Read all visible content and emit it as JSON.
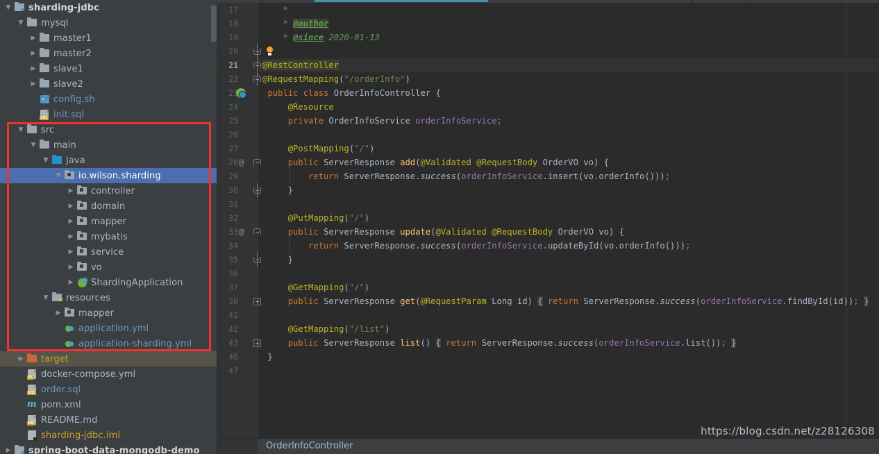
{
  "sidebar": {
    "scrollbar": "vertical-scrollbar",
    "tree": [
      {
        "depth": 0,
        "arrow": "down",
        "icon": "module-folder-icon",
        "label": "sharding-jdbc",
        "style": "bold"
      },
      {
        "depth": 1,
        "arrow": "down",
        "icon": "folder-icon",
        "label": "mysql",
        "style": "plain"
      },
      {
        "depth": 2,
        "arrow": "right",
        "icon": "folder-icon",
        "label": "master1",
        "style": "plain"
      },
      {
        "depth": 2,
        "arrow": "right",
        "icon": "folder-icon",
        "label": "master2",
        "style": "plain"
      },
      {
        "depth": 2,
        "arrow": "right",
        "icon": "folder-icon",
        "label": "slave1",
        "style": "plain"
      },
      {
        "depth": 2,
        "arrow": "right",
        "icon": "folder-icon",
        "label": "slave2",
        "style": "plain"
      },
      {
        "depth": 2,
        "arrow": "none",
        "icon": "shell-script-icon",
        "label": "config.sh",
        "style": "blue"
      },
      {
        "depth": 2,
        "arrow": "none",
        "icon": "sql-file-icon",
        "label": "init.sql",
        "style": "blue"
      },
      {
        "depth": 1,
        "arrow": "down",
        "icon": "folder-icon",
        "label": "src",
        "style": "plain"
      },
      {
        "depth": 2,
        "arrow": "down",
        "icon": "folder-icon",
        "label": "main",
        "style": "plain"
      },
      {
        "depth": 3,
        "arrow": "down",
        "icon": "source-root-icon",
        "label": "java",
        "style": "plain"
      },
      {
        "depth": 4,
        "arrow": "down",
        "icon": "package-icon",
        "label": "io.wilson.sharding",
        "style": "selected"
      },
      {
        "depth": 5,
        "arrow": "right",
        "icon": "package-icon",
        "label": "controller",
        "style": "plain"
      },
      {
        "depth": 5,
        "arrow": "right",
        "icon": "package-icon",
        "label": "domain",
        "style": "plain"
      },
      {
        "depth": 5,
        "arrow": "right",
        "icon": "package-icon",
        "label": "mapper",
        "style": "plain"
      },
      {
        "depth": 5,
        "arrow": "right",
        "icon": "package-icon",
        "label": "mybatis",
        "style": "plain"
      },
      {
        "depth": 5,
        "arrow": "right",
        "icon": "package-icon",
        "label": "service",
        "style": "plain"
      },
      {
        "depth": 5,
        "arrow": "right",
        "icon": "package-icon",
        "label": "vo",
        "style": "plain"
      },
      {
        "depth": 5,
        "arrow": "right",
        "icon": "spring-class-icon",
        "label": "ShardingApplication",
        "style": "plain"
      },
      {
        "depth": 3,
        "arrow": "down",
        "icon": "resources-root-icon",
        "label": "resources",
        "style": "plain"
      },
      {
        "depth": 4,
        "arrow": "right",
        "icon": "package-icon",
        "label": "mapper",
        "style": "plain"
      },
      {
        "depth": 4,
        "arrow": "none",
        "icon": "yaml-file-icon",
        "label": "application.yml",
        "style": "blue"
      },
      {
        "depth": 4,
        "arrow": "none",
        "icon": "yaml-file-icon",
        "label": "application-sharding.yml",
        "style": "blue"
      },
      {
        "depth": 1,
        "arrow": "right",
        "icon": "target-folder-icon",
        "label": "target",
        "style": "target"
      },
      {
        "depth": 1,
        "arrow": "none",
        "icon": "dc-file-icon",
        "label": "docker-compose.yml",
        "style": "plain"
      },
      {
        "depth": 1,
        "arrow": "none",
        "icon": "sql-file-icon",
        "label": "order.sql",
        "style": "blue"
      },
      {
        "depth": 1,
        "arrow": "none",
        "icon": "maven-file-icon",
        "label": "pom.xml",
        "style": "plain"
      },
      {
        "depth": 1,
        "arrow": "none",
        "icon": "md-file-icon",
        "label": "README.md",
        "style": "plain"
      },
      {
        "depth": 1,
        "arrow": "none",
        "icon": "iml-file-icon",
        "label": "sharding-jdbc.iml",
        "style": "yellow"
      },
      {
        "depth": 0,
        "arrow": "right",
        "icon": "module-folder-icon",
        "label": "spring-boot-data-mongodb-demo",
        "style": "bold"
      }
    ],
    "annotation": {
      "name": "red-highlight-box",
      "color": "#f6302a"
    }
  },
  "editor": {
    "tab_accent_color": "#4a8fa8",
    "current_line": 21,
    "lines": [
      {
        "num": "17",
        "gutter": "",
        "html": "    <span class='cm'>*</span>"
      },
      {
        "num": "18",
        "gutter": "",
        "html": "    <span class='cm'>* </span><span class='tg hl-tag'>@author</span>"
      },
      {
        "num": "19",
        "gutter": "",
        "html": "    <span class='cm'>* </span><span class='tg'>@since</span><span class='cm'> 2020-01-13</span>"
      },
      {
        "num": "20",
        "gutter": "foldbot",
        "html": ""
      },
      {
        "num": "21",
        "gutter": "foldtop",
        "html": "<span class='an hl-tag'>@RestController</span>"
      },
      {
        "num": "22",
        "gutter": "foldtop",
        "html": "<span class='an'>@RequestMapping</span>(<span class='st'>\"/orderInfo\"</span>)"
      },
      {
        "num": "23",
        "gutter": "class",
        "html": " <span class='k'>public class </span><span class='ty'>OrderInfoController </span>{"
      },
      {
        "num": "24",
        "gutter": "",
        "html": "     <span class='an'>@Resource</span>"
      },
      {
        "num": "25",
        "gutter": "",
        "html": "     <span class='k'>private </span><span class='ty'>OrderInfoService </span><span class='fd'>orderInfoService</span><span class='sep'>;</span>"
      },
      {
        "num": "26",
        "gutter": "",
        "html": ""
      },
      {
        "num": "27",
        "gutter": "",
        "html": "     <span class='an'>@PostMapping</span>(<span class='st'>\"/\"</span>)"
      },
      {
        "num": "28",
        "gutter": "at",
        "html": "     <span class='k'>public </span><span class='ty'>ServerResponse </span><span class='mi'>add</span>(<span class='an'>@Validated </span><span class='an'>@RequestBody </span><span class='ty'>OrderVO vo</span>) {"
      },
      {
        "num": "29",
        "gutter": "indent",
        "html": "         <span class='k'>return </span><span class='ty'>ServerResponse.</span><span class='sm'>success</span>(<span class='fd'>orderInfoService</span>.insert(vo.orderInfo()))<span class='sep'>;</span>"
      },
      {
        "num": "30",
        "gutter": "foldbot",
        "html": "     }"
      },
      {
        "num": "31",
        "gutter": "",
        "html": ""
      },
      {
        "num": "32",
        "gutter": "",
        "html": "     <span class='an'>@PutMapping</span>(<span class='st'>\"/\"</span>)"
      },
      {
        "num": "33",
        "gutter": "at",
        "html": "     <span class='k'>public </span><span class='ty'>ServerResponse </span><span class='mi'>update</span>(<span class='an'>@Validated </span><span class='an'>@RequestBody </span><span class='ty'>OrderVO vo</span>) {"
      },
      {
        "num": "34",
        "gutter": "indent",
        "html": "         <span class='k'>return </span><span class='ty'>ServerResponse.</span><span class='sm'>success</span>(<span class='fd'>orderInfoService</span>.updateById(vo.orderInfo()))<span class='sep'>;</span>"
      },
      {
        "num": "35",
        "gutter": "foldbot",
        "html": "     }"
      },
      {
        "num": "36",
        "gutter": "",
        "html": ""
      },
      {
        "num": "37",
        "gutter": "",
        "html": "     <span class='an'>@GetMapping</span>(<span class='st'>\"/\"</span>)"
      },
      {
        "num": "38",
        "gutter": "plus",
        "html": "     <span class='k'>public </span><span class='ty'>ServerResponse </span><span class='mi'>get</span>(<span class='an'>@RequestParam </span><span class='ty'>Long id</span>) <span class='hl-brace'>{</span> <span class='k'>return </span><span class='ty'>ServerResponse.</span><span class='sm'>success</span>(<span class='fd'>orderInfoService</span>.findById(id))<span class='sep'>;</span> <span class='hl-brace'>}</span>"
      },
      {
        "num": "41",
        "gutter": "",
        "html": ""
      },
      {
        "num": "42",
        "gutter": "",
        "html": "     <span class='an'>@GetMapping</span>(<span class='st'>\"/list\"</span>)"
      },
      {
        "num": "43",
        "gutter": "plus",
        "html": "     <span class='k'>public </span><span class='ty'>ServerResponse </span><span class='mi'>list</span>() <span class='hl-brace'>{</span> <span class='k'>return </span><span class='ty'>ServerResponse.</span><span class='sm'>success</span>(<span class='fd'>orderInfoService</span>.list())<span class='sep'>;</span> <span class='hl-brace'>}</span>"
      },
      {
        "num": "46",
        "gutter": "",
        "html": " }"
      },
      {
        "num": "47",
        "gutter": "",
        "html": ""
      }
    ],
    "breadcrumb": "OrderInfoController",
    "watermark": "https://blog.csdn.net/z28126308"
  }
}
